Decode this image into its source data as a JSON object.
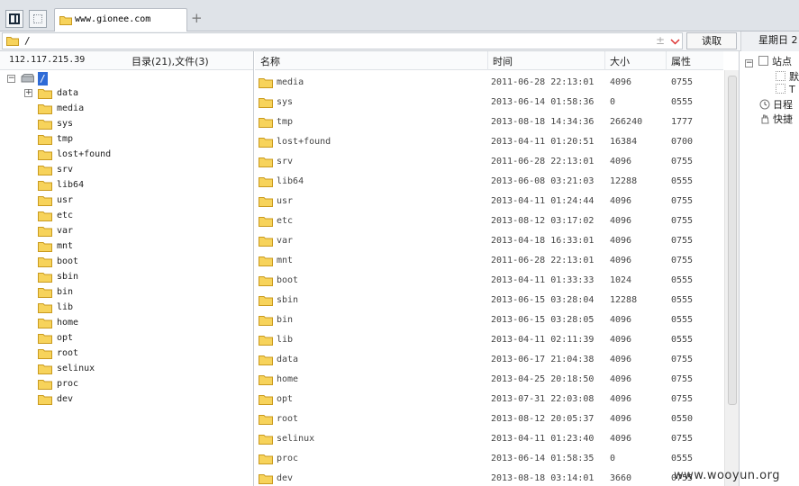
{
  "tabs": [
    {
      "label": "www.gionee.com",
      "active": true
    }
  ],
  "new_tab_symbol": "+",
  "address": {
    "path": "/",
    "plus_symbol": "±",
    "read_button": "读取"
  },
  "top_right": {
    "weekday": "星期日 2"
  },
  "server": {
    "ip": "112.117.215.39",
    "summary": "目录(21),文件(3)"
  },
  "tree": {
    "root_label": "/",
    "expander_minus": "−",
    "expander_plus": "+",
    "folders": [
      "data",
      "media",
      "sys",
      "tmp",
      "lost+found",
      "srv",
      "lib64",
      "usr",
      "etc",
      "var",
      "mnt",
      "boot",
      "sbin",
      "bin",
      "lib",
      "home",
      "opt",
      "root",
      "selinux",
      "proc",
      "dev"
    ]
  },
  "columns": {
    "name": "名称",
    "time": "时间",
    "size": "大小",
    "attr": "属性"
  },
  "files": [
    {
      "name": "media",
      "time": "2011-06-28 22:13:01",
      "size": "4096",
      "attr": "0755"
    },
    {
      "name": "sys",
      "time": "2013-06-14 01:58:36",
      "size": "0",
      "attr": "0555"
    },
    {
      "name": "tmp",
      "time": "2013-08-18 14:34:36",
      "size": "266240",
      "attr": "1777"
    },
    {
      "name": "lost+found",
      "time": "2013-04-11 01:20:51",
      "size": "16384",
      "attr": "0700"
    },
    {
      "name": "srv",
      "time": "2011-06-28 22:13:01",
      "size": "4096",
      "attr": "0755"
    },
    {
      "name": "lib64",
      "time": "2013-06-08 03:21:03",
      "size": "12288",
      "attr": "0555"
    },
    {
      "name": "usr",
      "time": "2013-04-11 01:24:44",
      "size": "4096",
      "attr": "0755"
    },
    {
      "name": "etc",
      "time": "2013-08-12 03:17:02",
      "size": "4096",
      "attr": "0755"
    },
    {
      "name": "var",
      "time": "2013-04-18 16:33:01",
      "size": "4096",
      "attr": "0755"
    },
    {
      "name": "mnt",
      "time": "2011-06-28 22:13:01",
      "size": "4096",
      "attr": "0755"
    },
    {
      "name": "boot",
      "time": "2013-04-11 01:33:33",
      "size": "1024",
      "attr": "0555"
    },
    {
      "name": "sbin",
      "time": "2013-06-15 03:28:04",
      "size": "12288",
      "attr": "0555"
    },
    {
      "name": "bin",
      "time": "2013-06-15 03:28:05",
      "size": "4096",
      "attr": "0555"
    },
    {
      "name": "lib",
      "time": "2013-04-11 02:11:39",
      "size": "4096",
      "attr": "0555"
    },
    {
      "name": "data",
      "time": "2013-06-17 21:04:38",
      "size": "4096",
      "attr": "0755"
    },
    {
      "name": "home",
      "time": "2013-04-25 20:18:50",
      "size": "4096",
      "attr": "0755"
    },
    {
      "name": "opt",
      "time": "2013-07-31 22:03:08",
      "size": "4096",
      "attr": "0755"
    },
    {
      "name": "root",
      "time": "2013-08-12 20:05:37",
      "size": "4096",
      "attr": "0550"
    },
    {
      "name": "selinux",
      "time": "2013-04-11 01:23:40",
      "size": "4096",
      "attr": "0755"
    },
    {
      "name": "proc",
      "time": "2013-06-14 01:58:35",
      "size": "0",
      "attr": "0555"
    },
    {
      "name": "dev",
      "time": "2013-08-18 03:14:01",
      "size": "3660",
      "attr": "0755"
    }
  ],
  "right_panel": {
    "site_root": "站点",
    "sub1": "默",
    "sub2": "T",
    "schedule": "日程",
    "shortcut": "快捷"
  },
  "watermark": "www.wooyun.org",
  "colors": {
    "folder_fill": "#f7d35b",
    "folder_stroke": "#c99a1e",
    "selection": "#2f6bd6",
    "tabbar_bg": "#dfe3e8"
  },
  "icons": {
    "folder": "folder-icon",
    "drive": "drive-icon",
    "expand": "expander-icon"
  }
}
